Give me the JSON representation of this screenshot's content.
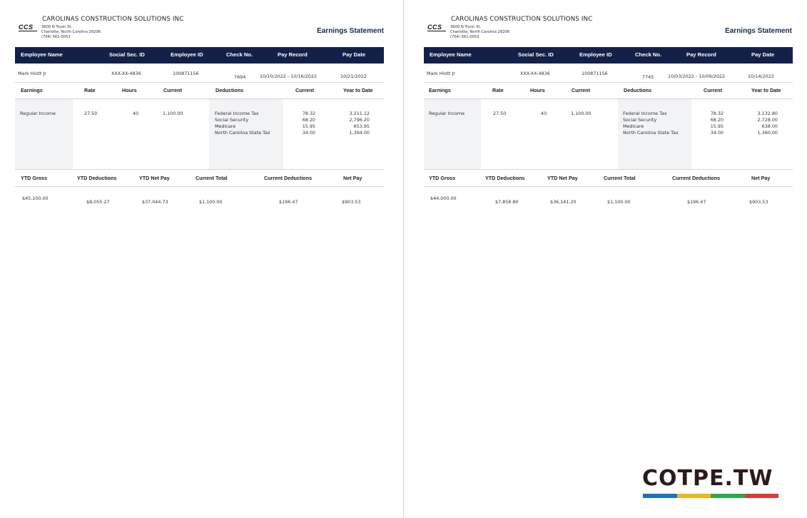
{
  "company": {
    "logo_text": "CCS",
    "name": "CAROLINAS CONSTRUCTION SOLUTIONS INC",
    "address_line1": "3600 N Tryon St.",
    "address_line2": "Charlotte, North Carolina 28206",
    "phone": "(704) 561-0053"
  },
  "statement_title": "Earnings Statement",
  "header_columns": [
    "Employee Name",
    "Social Sec. ID",
    "Employee ID",
    "Check No.",
    "Pay Record",
    "Pay Date"
  ],
  "sub_header_columns": [
    "Earnings",
    "Rate",
    "Hours",
    "Current",
    "Deductions",
    "Current",
    "Year to Date"
  ],
  "totals_columns": [
    "YTD Gross",
    "YTD Deductions",
    "YTD Net Pay",
    "Current Total",
    "Current Deductions",
    "Net Pay"
  ],
  "deduction_names": [
    "Federal Income Tax",
    "Social Security",
    "Medicare",
    "North Carolina State Tax"
  ],
  "statements": [
    {
      "employee_name": "Mark Hiott Jr",
      "ssn": "XXX-XX-4836",
      "employee_id": "100871156",
      "check_no": "7694",
      "pay_record": "10/10/2022 - 10/16/2022",
      "pay_date": "10/21/2022",
      "earning": {
        "label": "Regular Income",
        "rate": "27.50",
        "hours": "40",
        "current": "1,100.00"
      },
      "deductions_current": [
        "78.32",
        "68.20",
        "15.95",
        "34.00"
      ],
      "deductions_ytd": [
        "3,211.12",
        "2,796.20",
        "653.95",
        "1,394.00"
      ],
      "totals": {
        "ytd_gross": "$45,100.00",
        "ytd_deductions": "$8,055.27",
        "ytd_net_pay": "$37,044.73",
        "current_total": "$1,100.00",
        "current_deductions": "$196.47",
        "net_pay": "$903.53"
      }
    },
    {
      "employee_name": "Mark Hiott Jr",
      "ssn": "XXX-XX-4836",
      "employee_id": "100871156",
      "check_no": "7745",
      "pay_record": "10/03/2022 - 10/09/2022",
      "pay_date": "10/14/2022",
      "earning": {
        "label": "Regular Income",
        "rate": "27.50",
        "hours": "40",
        "current": "1,100.00"
      },
      "deductions_current": [
        "78.32",
        "68.20",
        "15.95",
        "34.00"
      ],
      "deductions_ytd": [
        "3,132.80",
        "2,728.00",
        "638.00",
        "1,360.00"
      ],
      "totals": {
        "ytd_gross": "$44,000.00",
        "ytd_deductions": "$7,858.80",
        "ytd_net_pay": "$36,141.20",
        "current_total": "$1,100.00",
        "current_deductions": "$196.47",
        "net_pay": "$903.53"
      }
    }
  ],
  "watermark": {
    "text": "COTPE.TW",
    "bar_colors": [
      "#1f6fc4",
      "#f2b51c",
      "#2fa84f",
      "#e03a34"
    ]
  }
}
